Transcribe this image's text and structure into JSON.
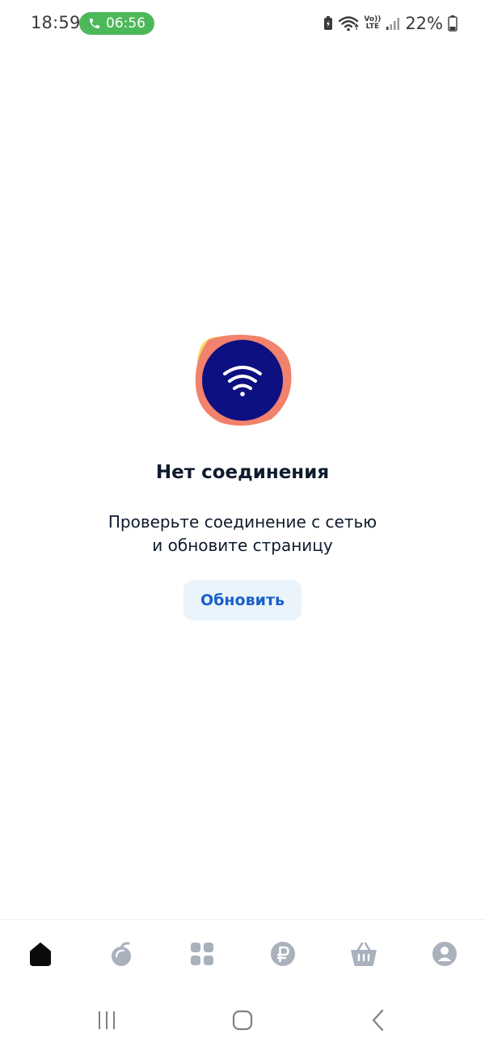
{
  "status_bar": {
    "time": "18:59",
    "call_duration": "06:56",
    "volte_top": "Vo))",
    "volte_bottom": "LTE",
    "battery_percent": "22%"
  },
  "error_state": {
    "icon": "wifi-icon",
    "title": "Нет соединения",
    "description_line1": "Проверьте соединение с сетью",
    "description_line2": "и обновите страницу",
    "refresh_label": "Обновить"
  },
  "bottom_nav": {
    "items": [
      {
        "icon": "home-icon",
        "active": true
      },
      {
        "icon": "fruit-icon",
        "active": false
      },
      {
        "icon": "catalog-grid-icon",
        "active": false
      },
      {
        "icon": "ruble-icon",
        "active": false
      },
      {
        "icon": "basket-icon",
        "active": false
      },
      {
        "icon": "profile-icon",
        "active": false
      }
    ]
  },
  "colors": {
    "accent_blue": "#1a5fc8",
    "dark_navy": "#0d1080",
    "coral": "#f2826b",
    "yellow": "#f7d96a",
    "call_green": "#4cb85a",
    "nav_icon_gray": "#a9b1bd",
    "button_bg": "#eaf4fc"
  }
}
